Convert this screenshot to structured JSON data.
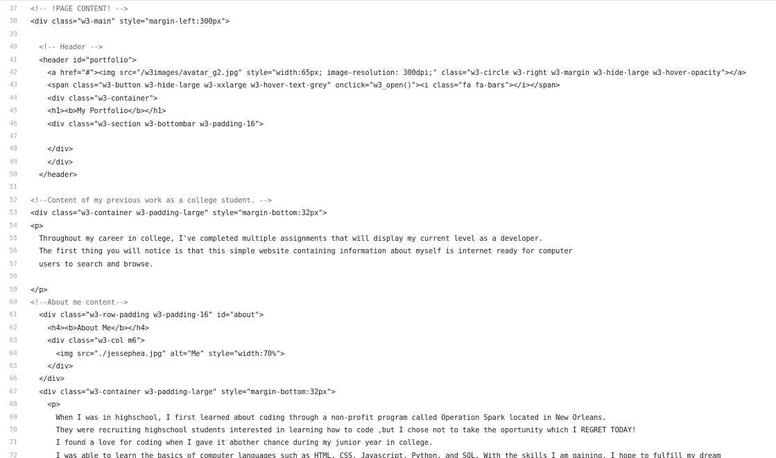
{
  "editor": {
    "lines": [
      {
        "num": "37",
        "text": "<!-- !PAGE CONTENT! -->",
        "kind": "comment"
      },
      {
        "num": "38",
        "text": "<div class=\"w3-main\" style=\"margin-left:300px\">",
        "kind": "code"
      },
      {
        "num": "39",
        "text": "",
        "kind": "code"
      },
      {
        "num": "40",
        "text": "  <!-- Header -->",
        "kind": "comment"
      },
      {
        "num": "41",
        "text": "  <header id=\"portfolio\">",
        "kind": "code"
      },
      {
        "num": "42",
        "text": "    <a href=\"#\"><img src=\"/w3images/avatar_g2.jpg\" style=\"width:65px; image-resolution: 300dpi;\" class=\"w3-circle w3-right w3-margin w3-hide-large w3-hover-opacity\"></a>",
        "kind": "code"
      },
      {
        "num": "43",
        "text": "    <span class=\"w3-button w3-hide-large w3-xxlarge w3-hover-text-grey\" onclick=\"w3_open()\"><i class=\"fa fa-bars\"></i></span>",
        "kind": "code"
      },
      {
        "num": "44",
        "text": "    <div class=\"w3-container\">",
        "kind": "code"
      },
      {
        "num": "45",
        "text": "    <h1><b>My Portfolio</b></h1>",
        "kind": "code"
      },
      {
        "num": "46",
        "text": "    <div class=\"w3-section w3-bottombar w3-padding-16\">",
        "kind": "code"
      },
      {
        "num": "47",
        "text": "",
        "kind": "code"
      },
      {
        "num": "48",
        "text": "    </div>",
        "kind": "code"
      },
      {
        "num": "49",
        "text": "    </div>",
        "kind": "code"
      },
      {
        "num": "50",
        "text": "  </header>",
        "kind": "code"
      },
      {
        "num": "51",
        "text": "",
        "kind": "code"
      },
      {
        "num": "52",
        "text": "<!--Content of my previous work as a college student. -->",
        "kind": "comment"
      },
      {
        "num": "53",
        "text": "<div class=\"w3-container w3-padding-large\" style=\"margin-bottom:32px\">",
        "kind": "code"
      },
      {
        "num": "54",
        "text": "<p>",
        "kind": "code"
      },
      {
        "num": "55",
        "text": "  Throughout my career in college, I've completed multiple assignments that will display my current level as a developer.",
        "kind": "code"
      },
      {
        "num": "56",
        "text": "  The first thing you will notice is that this simple website containing information about myself is internet ready for computer",
        "kind": "code"
      },
      {
        "num": "57",
        "text": "  users to search and browse.",
        "kind": "code"
      },
      {
        "num": "58",
        "text": "",
        "kind": "code"
      },
      {
        "num": "59",
        "text": "</p>",
        "kind": "code"
      },
      {
        "num": "60",
        "text": "<!--About me content-->",
        "kind": "comment"
      },
      {
        "num": "61",
        "text": "  <div class=\"w3-row-padding w3-padding-16\" id=\"about\">",
        "kind": "code"
      },
      {
        "num": "62",
        "text": "    <h4><b>About Me</b></h4>",
        "kind": "code"
      },
      {
        "num": "63",
        "text": "    <div class=\"w3-col m6\">",
        "kind": "code"
      },
      {
        "num": "64",
        "text": "      <img src=\"./jessephea.jpg\" alt=\"Me\" style=\"width:70%\">",
        "kind": "code"
      },
      {
        "num": "65",
        "text": "    </div>",
        "kind": "code"
      },
      {
        "num": "66",
        "text": "  </div>",
        "kind": "code"
      },
      {
        "num": "67",
        "text": "  <div class=\"w3-container w3-padding-large\" style=\"margin-bottom:32px\">",
        "kind": "code"
      },
      {
        "num": "68",
        "text": "    <p>",
        "kind": "code"
      },
      {
        "num": "69",
        "text": "      When I was in highschool, I first learned about coding through a non-profit program called Operation Spark located in New Orleans.",
        "kind": "code"
      },
      {
        "num": "70",
        "text": "      They were recruiting highschool students interested in learning how to code ,but I chose not to take the oportunity which I REGRET TODAY!",
        "kind": "code"
      },
      {
        "num": "71",
        "text": "      I found a love for coding when I gave it abother chance during my junior year in college.",
        "kind": "code"
      },
      {
        "num": "72",
        "text": "      I was able to learn the basics of computer languages such as HTML, CSS, Javascript, Python, and SQL. With the skills I am gaining, I hope to fulfill my dream",
        "kind": "code"
      }
    ]
  }
}
